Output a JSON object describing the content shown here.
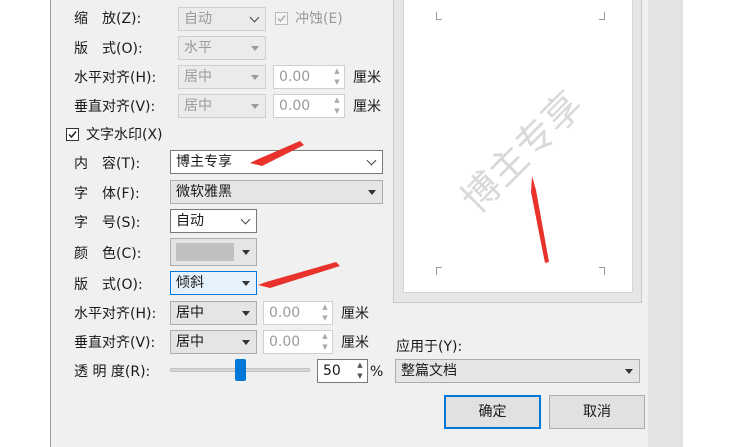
{
  "labels": {
    "scale": "缩　放(Z):",
    "layout_top": "版　式(O):",
    "h_align_top": "水平对齐(H):",
    "v_align_top": "垂直对齐(V):",
    "text_watermark": "文字水印(X)",
    "content": "内　容(T):",
    "font": "字　体(F):",
    "size": "字　号(S):",
    "color": "颜　色(C):",
    "layout": "版　式(O):",
    "h_align": "水平对齐(H):",
    "v_align": "垂直对齐(V):",
    "transparency": "透 明 度(R):",
    "apply_to": "应用于(Y):"
  },
  "values": {
    "scale": "自动",
    "washout": "冲蚀(E)",
    "layout_top": "水平",
    "h_align_top": "居中",
    "h_offset_top": "0.00",
    "v_align_top": "居中",
    "v_offset_top": "0.00",
    "unit": "厘米",
    "content": "博主专享",
    "font": "微软雅黑",
    "size": "自动",
    "layout": "倾斜",
    "h_align": "居中",
    "h_offset": "0.00",
    "v_align": "居中",
    "v_offset": "0.00",
    "transparency": "50",
    "percent": "%",
    "apply_to": "整篇文档"
  },
  "state": {
    "text_watermark_checked": true,
    "washout_checked": true,
    "transparency_fraction": 0.5
  },
  "preview": {
    "watermark_text": "博主专享"
  },
  "buttons": {
    "ok": "确定",
    "cancel": "取消"
  },
  "colors": {
    "annotation_arrow": "#e8322b",
    "primary_border": "#0078d7",
    "slider_thumb": "#0078d7"
  }
}
